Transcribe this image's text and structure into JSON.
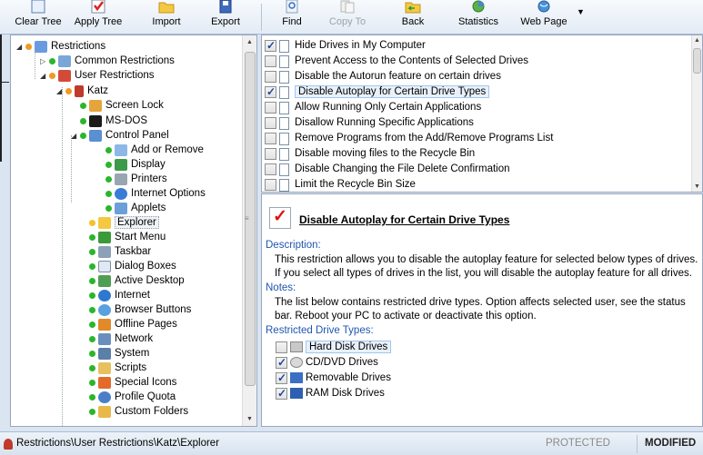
{
  "toolbar": {
    "clear_tree": "Clear Tree",
    "apply_tree": "Apply Tree",
    "import": "Import",
    "export": "Export",
    "find": "Find",
    "copy_to": "Copy To",
    "back": "Back",
    "statistics": "Statistics",
    "web_page": "Web Page"
  },
  "tree": {
    "items": [
      {
        "label": "Restrictions",
        "icon": "restrictions-icon"
      },
      {
        "label": "Common Restrictions",
        "icon": "users-icon"
      },
      {
        "label": "User Restrictions",
        "icon": "users-icon"
      },
      {
        "label": "Katz",
        "icon": "user-icon"
      },
      {
        "label": "Screen Lock",
        "icon": "screen-lock-icon"
      },
      {
        "label": "MS-DOS",
        "icon": "msdos-icon"
      },
      {
        "label": "Control Panel",
        "icon": "control-panel-icon"
      },
      {
        "label": "Add or Remove",
        "icon": "add-remove-icon"
      },
      {
        "label": "Display",
        "icon": "display-icon"
      },
      {
        "label": "Printers",
        "icon": "printer-icon"
      },
      {
        "label": "Internet Options",
        "icon": "internet-options-icon"
      },
      {
        "label": "Applets",
        "icon": "applets-icon"
      },
      {
        "label": "Explorer",
        "icon": "folder-icon"
      },
      {
        "label": "Start Menu",
        "icon": "start-menu-icon"
      },
      {
        "label": "Taskbar",
        "icon": "taskbar-icon"
      },
      {
        "label": "Dialog Boxes",
        "icon": "dialog-box-icon"
      },
      {
        "label": "Active Desktop",
        "icon": "active-desktop-icon"
      },
      {
        "label": "Internet",
        "icon": "internet-icon"
      },
      {
        "label": "Browser Buttons",
        "icon": "browser-buttons-icon"
      },
      {
        "label": "Offline Pages",
        "icon": "offline-pages-icon"
      },
      {
        "label": "Network",
        "icon": "network-icon"
      },
      {
        "label": "System",
        "icon": "system-icon"
      },
      {
        "label": "Scripts",
        "icon": "scripts-icon"
      },
      {
        "label": "Special Icons",
        "icon": "special-icons-icon"
      },
      {
        "label": "Profile Quota",
        "icon": "profile-quota-icon"
      },
      {
        "label": "Custom Folders",
        "icon": "custom-folders-icon"
      }
    ]
  },
  "restrictions": {
    "items": [
      {
        "label": "Hide Drives in My Computer",
        "checked": true
      },
      {
        "label": "Prevent Access to the Contents of Selected Drives",
        "checked": false
      },
      {
        "label": "Disable the Autorun feature on certain drives",
        "checked": false
      },
      {
        "label": "Disable Autoplay for Certain Drive Types",
        "checked": true
      },
      {
        "label": "Allow Running Only Certain Applications",
        "checked": false
      },
      {
        "label": "Disallow Running Specific Applications",
        "checked": false
      },
      {
        "label": "Remove Programs from the Add/Remove Programs List",
        "checked": false
      },
      {
        "label": "Disable moving files to the Recycle Bin",
        "checked": false
      },
      {
        "label": "Disable Changing the File Delete Confirmation",
        "checked": false
      },
      {
        "label": "Limit the Recycle Bin Size",
        "checked": false
      }
    ]
  },
  "details": {
    "title": "Disable Autoplay for Certain Drive Types",
    "description_label": "Description:",
    "description": "This restriction allows you to disable the autoplay feature for selected below types of drives. If you select all types of drives in the list, you will disable the autoplay feature for all drives.",
    "notes_label": "Notes:",
    "notes": "The list below contains restricted drive types. Option affects selected user, see the status bar. Reboot your PC to activate or deactivate this option.",
    "drive_types_label": "Restricted Drive Types:",
    "drive_types": [
      {
        "label": "Hard Disk Drives",
        "checked": false,
        "icon": "hard-disk-icon"
      },
      {
        "label": "CD/DVD Drives",
        "checked": true,
        "icon": "cd-dvd-icon"
      },
      {
        "label": "Removable Drives",
        "checked": true,
        "icon": "removable-drive-icon"
      },
      {
        "label": "RAM Disk Drives",
        "checked": true,
        "icon": "ram-disk-icon"
      }
    ]
  },
  "status": {
    "path": "Restrictions\\User Restrictions\\Katz\\Explorer",
    "protected": "PROTECTED",
    "modified": "MODIFIED"
  }
}
